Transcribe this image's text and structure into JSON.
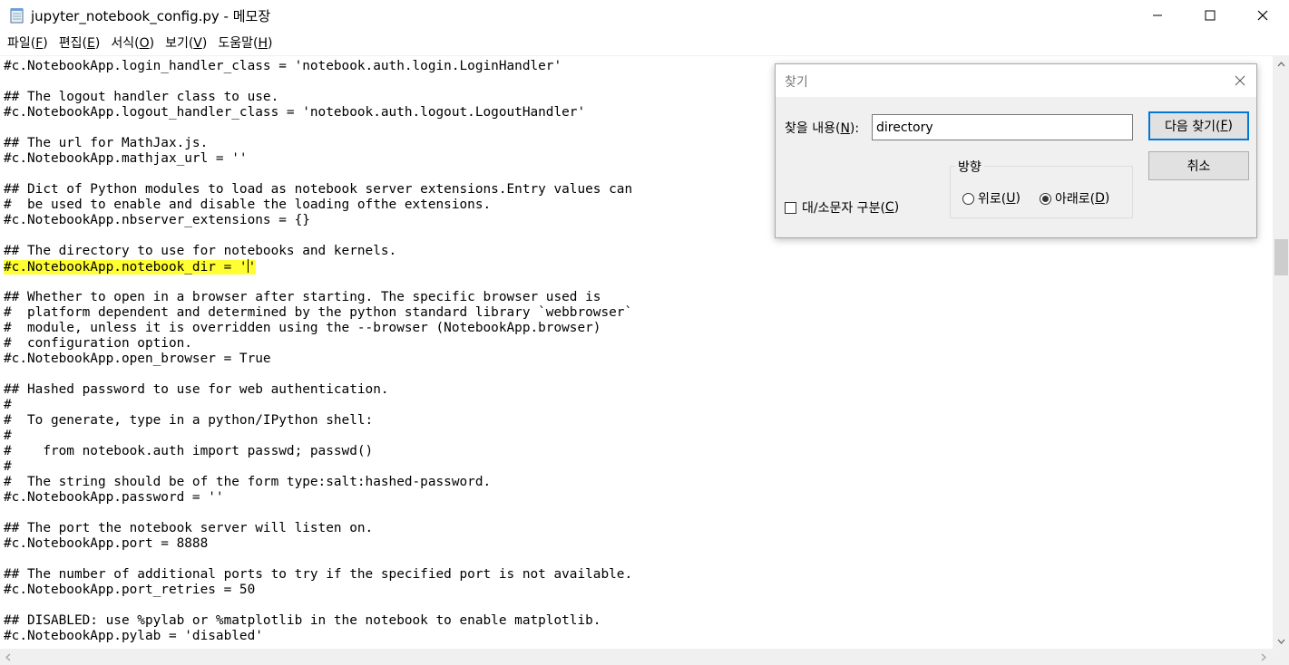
{
  "window": {
    "title": "jupyter_notebook_config.py - 메모장",
    "minimize_label": "—",
    "maximize_label": "☐",
    "close_label": "✕",
    "icon": "notepad-icon"
  },
  "menu": [
    {
      "text": "파일(",
      "key": "F",
      "suffix": ")"
    },
    {
      "text": "편집(",
      "key": "E",
      "suffix": ")"
    },
    {
      "text": "서식(",
      "key": "O",
      "suffix": ")"
    },
    {
      "text": "보기(",
      "key": "V",
      "suffix": ")"
    },
    {
      "text": "도움말(",
      "key": "H",
      "suffix": ")"
    }
  ],
  "editor": {
    "highlight_color": "#ffff33",
    "lines": [
      "#c.NotebookApp.login_handler_class = 'notebook.auth.login.LoginHandler'",
      "",
      "## The logout handler class to use.",
      "#c.NotebookApp.logout_handler_class = 'notebook.auth.logout.LogoutHandler'",
      "",
      "## The url for MathJax.js.",
      "#c.NotebookApp.mathjax_url = ''",
      "",
      "## Dict of Python modules to load as notebook server extensions.Entry values can",
      "#  be used to enable and disable the loading ofthe extensions.",
      "#c.NotebookApp.nbserver_extensions = {}",
      "",
      "## The directory to use for notebooks and kernels.",
      "#c.NotebookApp.notebook_dir = ''",
      "",
      "## Whether to open in a browser after starting. The specific browser used is",
      "#  platform dependent and determined by the python standard library `webbrowser`",
      "#  module, unless it is overridden using the --browser (NotebookApp.browser)",
      "#  configuration option.",
      "#c.NotebookApp.open_browser = True",
      "",
      "## Hashed password to use for web authentication.",
      "#",
      "#  To generate, type in a python/IPython shell:",
      "#",
      "#    from notebook.auth import passwd; passwd()",
      "#",
      "#  The string should be of the form type:salt:hashed-password.",
      "#c.NotebookApp.password = ''",
      "",
      "## The port the notebook server will listen on.",
      "#c.NotebookApp.port = 8888",
      "",
      "## The number of additional ports to try if the specified port is not available.",
      "#c.NotebookApp.port_retries = 50",
      "",
      "## DISABLED: use %pylab or %matplotlib in the notebook to enable matplotlib.",
      "#c.NotebookApp.pylab = 'disabled'"
    ]
  },
  "find_dialog": {
    "title": "찾기",
    "find_label": "찾을 내용(",
    "find_label_key": "N",
    "find_label_suffix": "):",
    "find_value": "directory",
    "find_next_label": "다음 찾기(",
    "find_next_key": "F",
    "find_next_suffix": ")",
    "cancel_label": "취소",
    "direction_title": "방향",
    "up_label": "위로(",
    "up_key": "U",
    "up_suffix": ")",
    "down_label": "아래로(",
    "down_key": "D",
    "down_suffix": ")",
    "match_case_label": "대/소문자 구분(",
    "match_case_key": "C",
    "match_case_suffix": ")",
    "direction_selected": "down",
    "match_case_checked": false
  }
}
